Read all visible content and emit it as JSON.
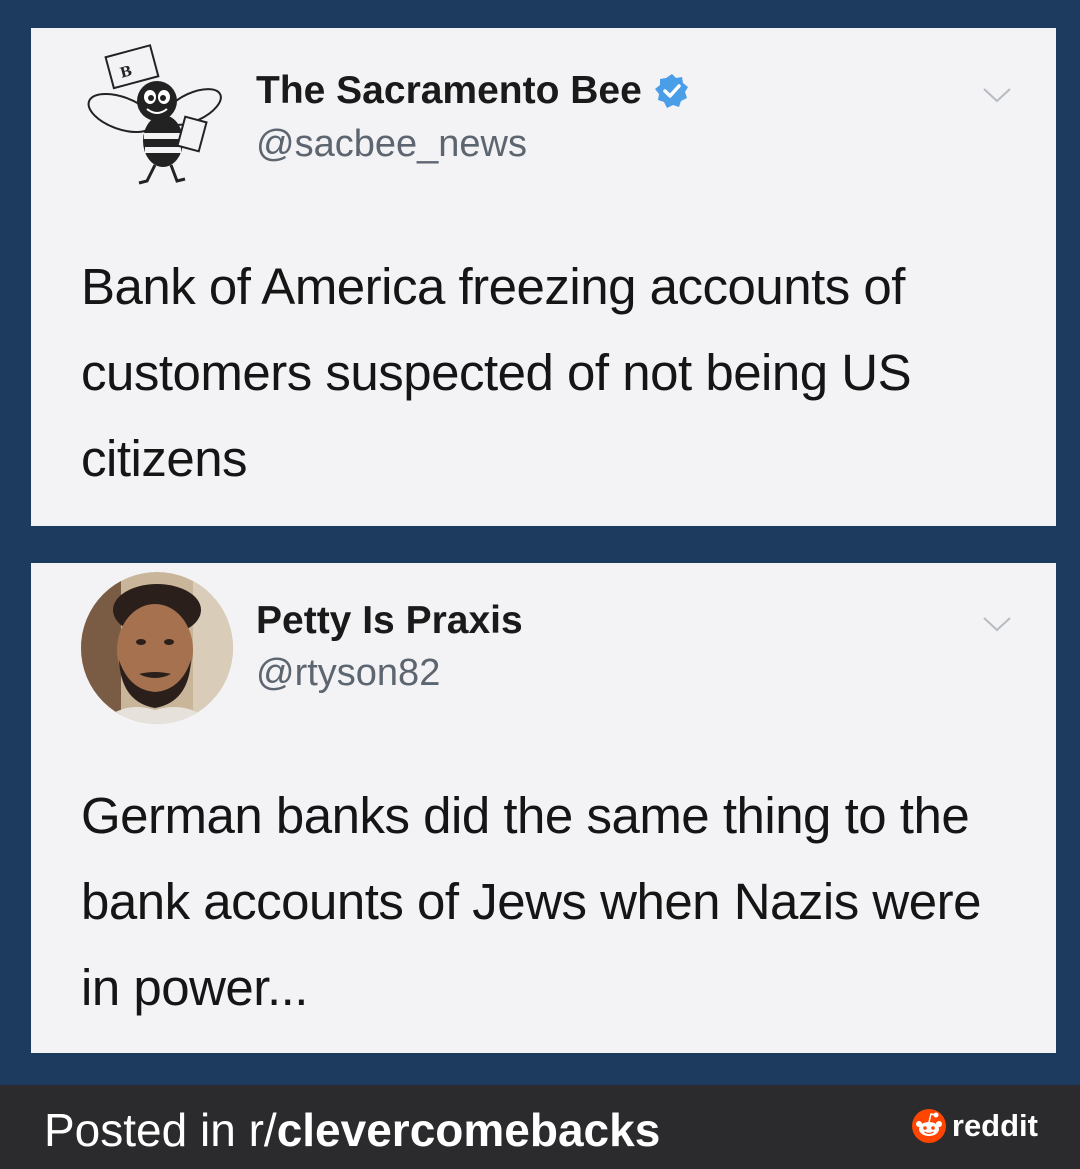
{
  "tweets": [
    {
      "name": "The Sacramento Bee",
      "handle": "@sacbee_news",
      "verified": true,
      "avatar_icon": "bee-mascot-logo",
      "text": "Bank of America freezing accounts of customers suspected of not being US citizens"
    },
    {
      "name": "Petty Is Praxis",
      "handle": "@rtyson82",
      "verified": false,
      "avatar_icon": "profile-photo",
      "text": "German banks did the same thing to the bank accounts of Jews when Nazis were in power..."
    }
  ],
  "footer": {
    "posted_prefix": "Posted in r/",
    "subreddit": "clevercomebacks",
    "brand": "reddit"
  },
  "colors": {
    "background": "#1d3b5e",
    "card": "#f3f2f5",
    "verified": "#4a9ee8",
    "footer": "#2b2b2d",
    "reddit_orange": "#ff4500"
  }
}
